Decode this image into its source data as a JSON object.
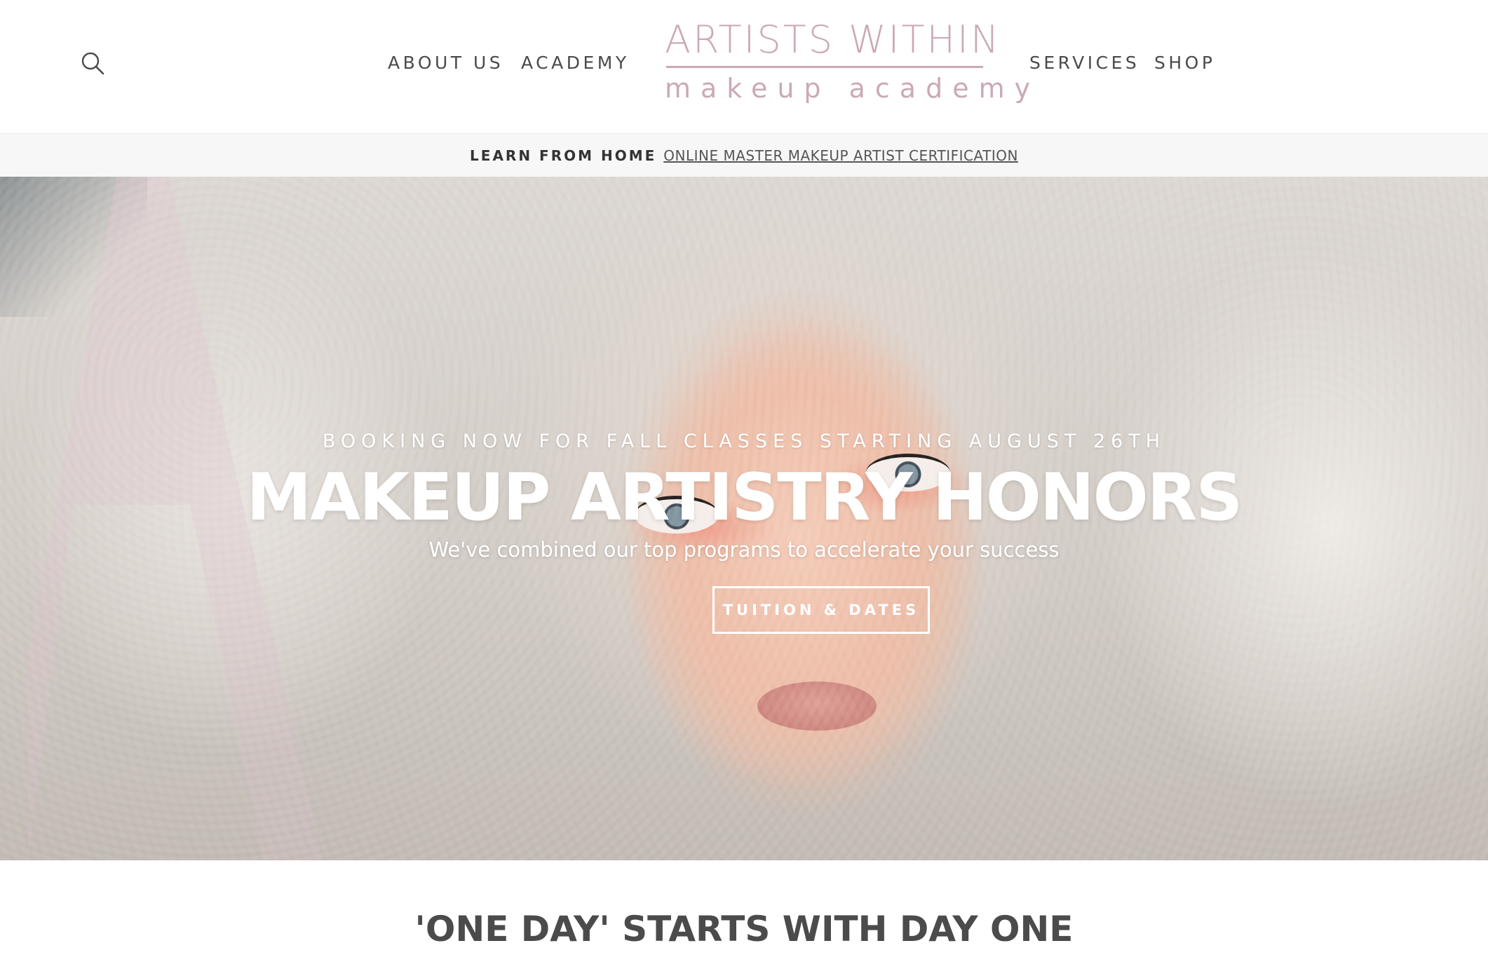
{
  "header": {
    "nav_left": [
      {
        "label": "ABOUT US"
      },
      {
        "label": "ACADEMY"
      }
    ],
    "nav_right": [
      {
        "label": "SERVICES"
      },
      {
        "label": "SHOP"
      }
    ],
    "logo": {
      "top_text": "ARTISTS WITHIN",
      "bottom_text": "makeup academy"
    },
    "icons": {
      "search": "search-icon"
    }
  },
  "announcement": {
    "lead": "LEARN FROM HOME",
    "link_text": "ONLINE MASTER MAKEUP ARTIST CERTIFICATION"
  },
  "hero": {
    "kicker": "BOOKING NOW FOR FALL CLASSES STARTING AUGUST 26TH",
    "title": "MAKEUP ARTISTRY HONORS",
    "subtitle": "We've combined our top programs to accelerate your success",
    "button_label": "TUITION & DATES"
  },
  "section": {
    "heading": "'ONE DAY' STARTS WITH DAY ONE"
  },
  "colors": {
    "logo_pink": "#cba9b6",
    "nav_text": "#4a4a4a",
    "announce_bg": "#f7f7f7",
    "hero_text": "#ffffff"
  }
}
